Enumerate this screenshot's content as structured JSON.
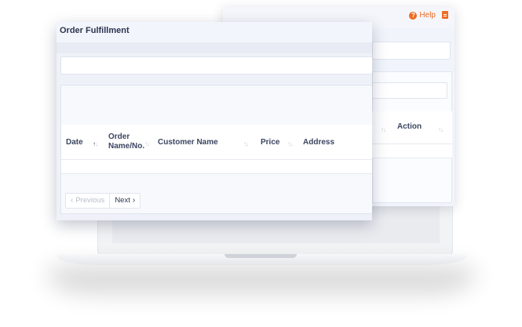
{
  "back_window": {
    "help_label": "Help",
    "help_icon": "question-circle-icon",
    "doc_icon": "document-icon",
    "table": {
      "column_action": "Action"
    }
  },
  "front_window": {
    "title": "Order Fulfillment",
    "table": {
      "columns": {
        "date": "Date",
        "order_line1": "Order",
        "order_line2": "Name/No.",
        "customer": "Customer Name",
        "price": "Price",
        "address": "Address"
      },
      "sort_icon": "sort-icon",
      "rows": []
    },
    "pagination": {
      "previous_label": "Previous",
      "next_label": "Next"
    }
  },
  "colors": {
    "accent": "#ee6b21",
    "text": "#3b4560",
    "panel": "#eef1f8"
  }
}
